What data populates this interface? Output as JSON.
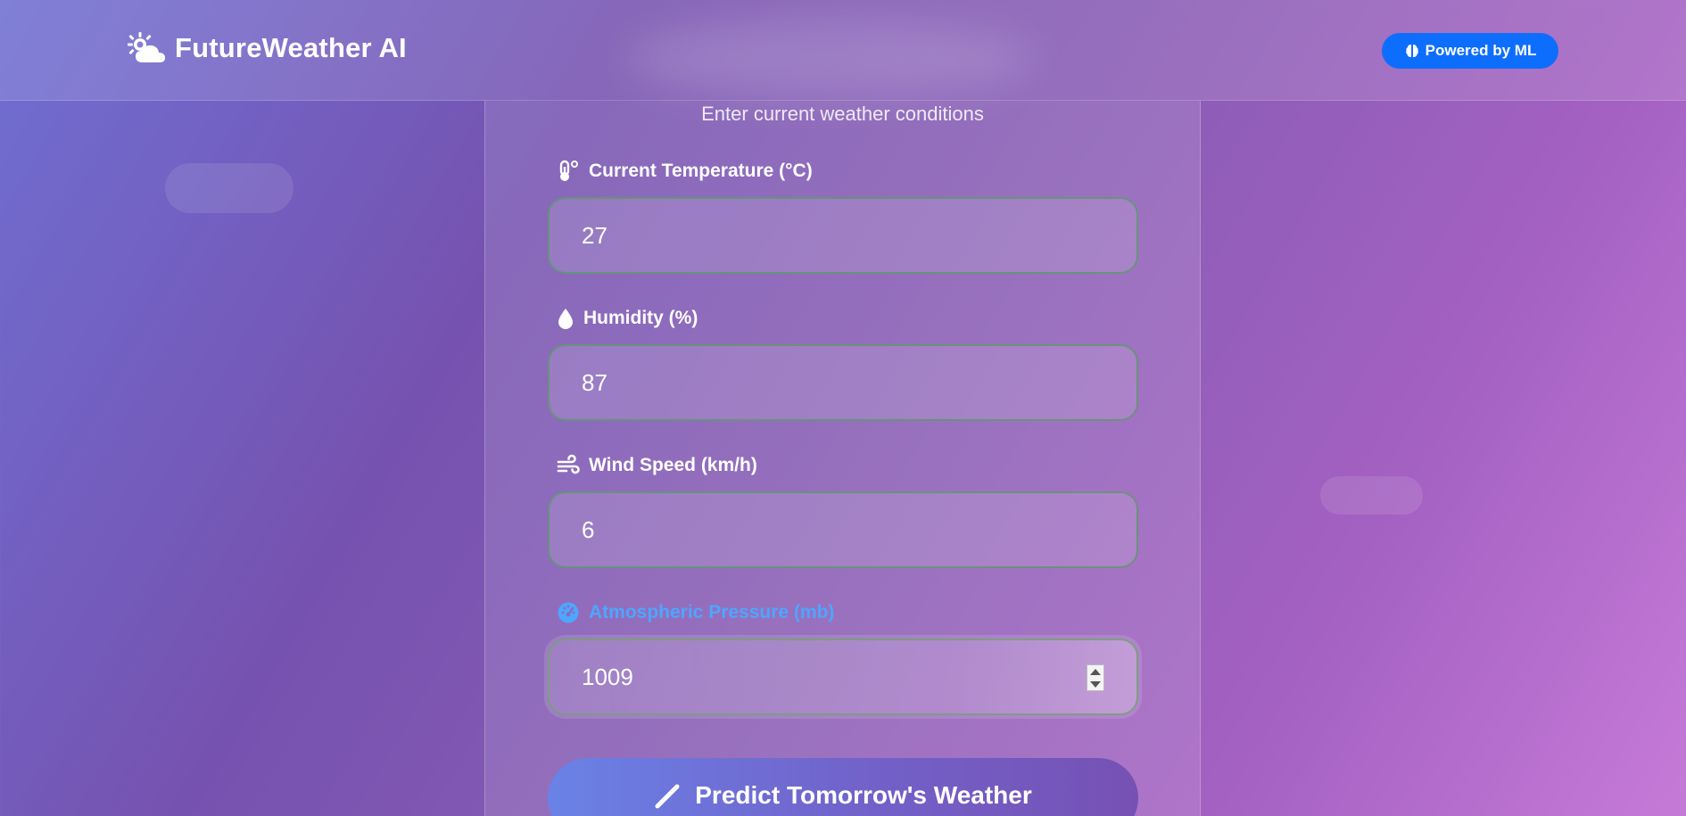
{
  "header": {
    "brand_icon": "sun-behind-cloud-icon",
    "title": "FutureWeather AI",
    "badge_icon": "brain-icon",
    "badge_label": "Powered by ML",
    "badge_color": "#0d6efd"
  },
  "form": {
    "subtitle": "Enter current weather conditions",
    "fields": [
      {
        "icon": "thermometer-icon",
        "label": "Current Temperature (°C)",
        "value": "27"
      },
      {
        "icon": "droplet-icon",
        "label": "Humidity (%)",
        "value": "87"
      },
      {
        "icon": "wind-icon",
        "label": "Wind Speed (km/h)",
        "value": "6"
      },
      {
        "icon": "gauge-icon",
        "label": "Atmospheric Pressure (mb)",
        "value": "1009",
        "focused": true
      }
    ],
    "submit_icon": "magic-wand-icon",
    "submit_label": "Predict Tomorrow's Weather"
  },
  "colors": {
    "active_label": "#4ea6ff",
    "input_border": "#5e966e"
  }
}
